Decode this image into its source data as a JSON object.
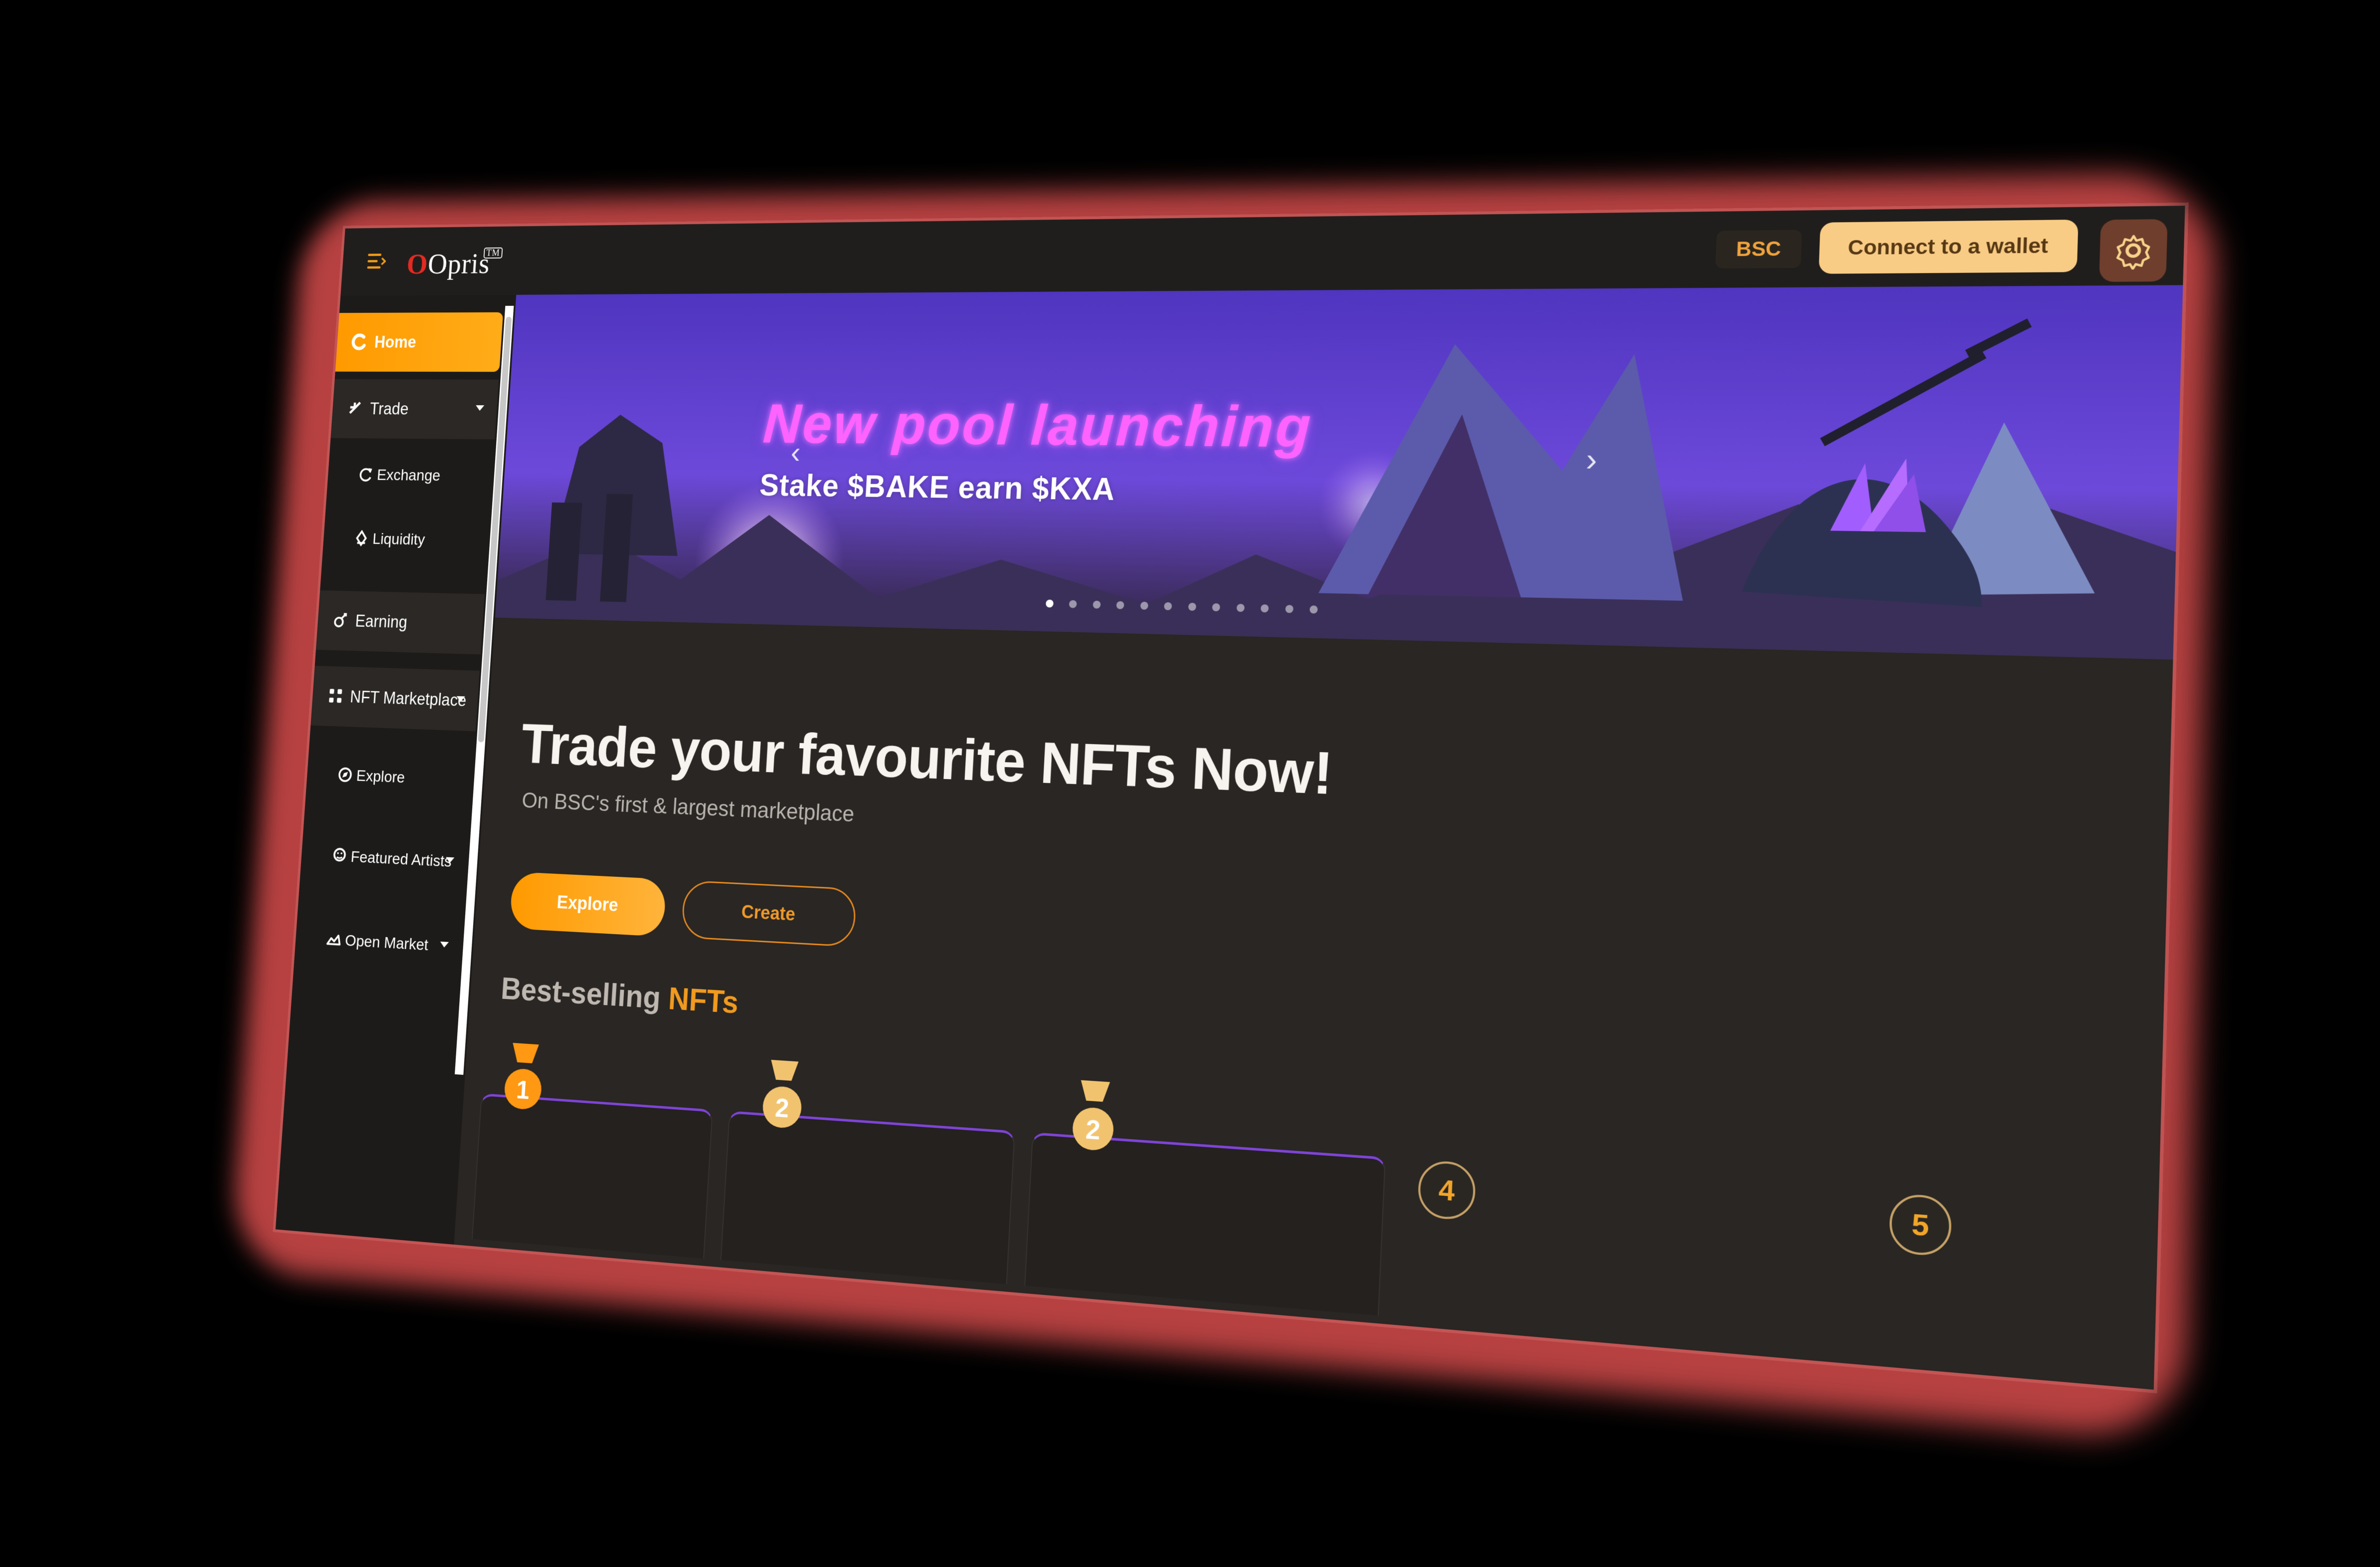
{
  "header": {
    "logo_text": "Opris",
    "logo_mark": "TM",
    "network_label": "BSC",
    "wallet_button_label": "Connect to a wallet",
    "settings_icon": "gear-icon",
    "menu_icon": "menu-icon"
  },
  "sidebar": {
    "items": [
      {
        "label": "Home",
        "icon": "home-icon"
      },
      {
        "label": "Trade",
        "icon": "trade-icon"
      },
      {
        "label": "Exchange",
        "icon": "exchange-icon"
      },
      {
        "label": "Liquidity",
        "icon": "liquidity-icon"
      },
      {
        "label": "Earning",
        "icon": "earning-icon"
      },
      {
        "label": "NFT Marketplace",
        "icon": "grid-icon"
      },
      {
        "label": "Explore",
        "icon": "explore-icon"
      },
      {
        "label": "Featured Artists",
        "icon": "artist-icon"
      },
      {
        "label": "Open Market",
        "icon": "market-icon"
      }
    ]
  },
  "banner": {
    "title": "New pool launching",
    "subtitle": "Stake $BAKE earn $KXA"
  },
  "hero": {
    "title": "Trade your favourite NFTs Now!",
    "subtitle": "On BSC's first & largest marketplace",
    "explore_label": "Explore",
    "create_label": "Create"
  },
  "best_selling": {
    "title_part_1": "Best-selling",
    "title_part_2": "NFTs",
    "ranks": [
      "1",
      "2",
      "2",
      "4",
      "5"
    ]
  },
  "colors": {
    "accent": "#FF9A00",
    "wallet_button": "#F9CC86",
    "banner_title": "#FF63FF",
    "background": "#292623"
  }
}
